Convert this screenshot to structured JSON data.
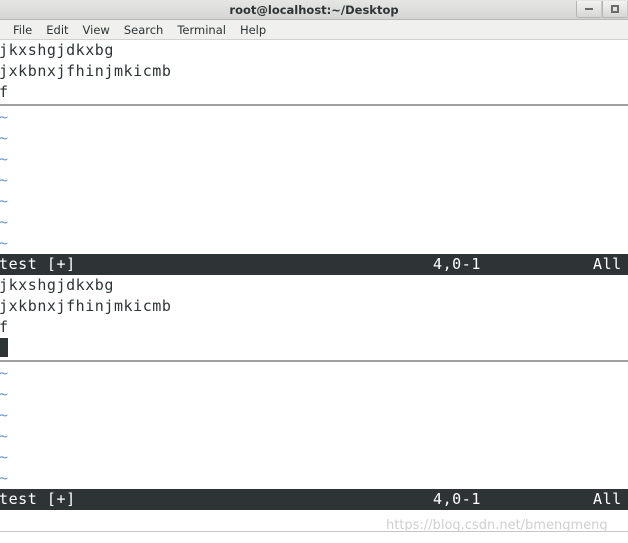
{
  "window": {
    "title": "root@localhost:~/Desktop",
    "buttons": [
      {
        "name": "minimize",
        "glyph": "minimize-icon"
      },
      {
        "name": "maximize",
        "glyph": "maximize-icon"
      }
    ]
  },
  "menubar": {
    "items": [
      {
        "label": "File"
      },
      {
        "label": "Edit"
      },
      {
        "label": "View"
      },
      {
        "label": "Search"
      },
      {
        "label": "Terminal"
      },
      {
        "label": "Help"
      }
    ]
  },
  "editor": {
    "tilde_char": "~",
    "panes": [
      {
        "lines": [
          "jkxshgjdkxbg",
          "jxkbnxjfhinjmkicmb",
          "f"
        ],
        "empty_marker_count": 7,
        "cursor_visible": false,
        "status": {
          "filename": "test [+]",
          "position": "4,0-1",
          "percent": "All"
        }
      },
      {
        "lines": [
          "jkxshgjdkxbg",
          "jxkbnxjfhinjmkicmb",
          "f"
        ],
        "empty_marker_count": 6,
        "cursor_visible": true,
        "status": {
          "filename": "test [+]",
          "position": "4,0-1",
          "percent": "All"
        }
      }
    ]
  },
  "watermark": {
    "text": "https://blog.csdn.net/bmengmeng"
  },
  "colors": {
    "terminal_bg": "#ffffff",
    "terminal_fg": "#2e3436",
    "status_bg": "#2e3436",
    "status_fg": "#ffffff",
    "tilde_fg": "#6c9ad2",
    "titlebar_bg": "#dcdcda"
  }
}
